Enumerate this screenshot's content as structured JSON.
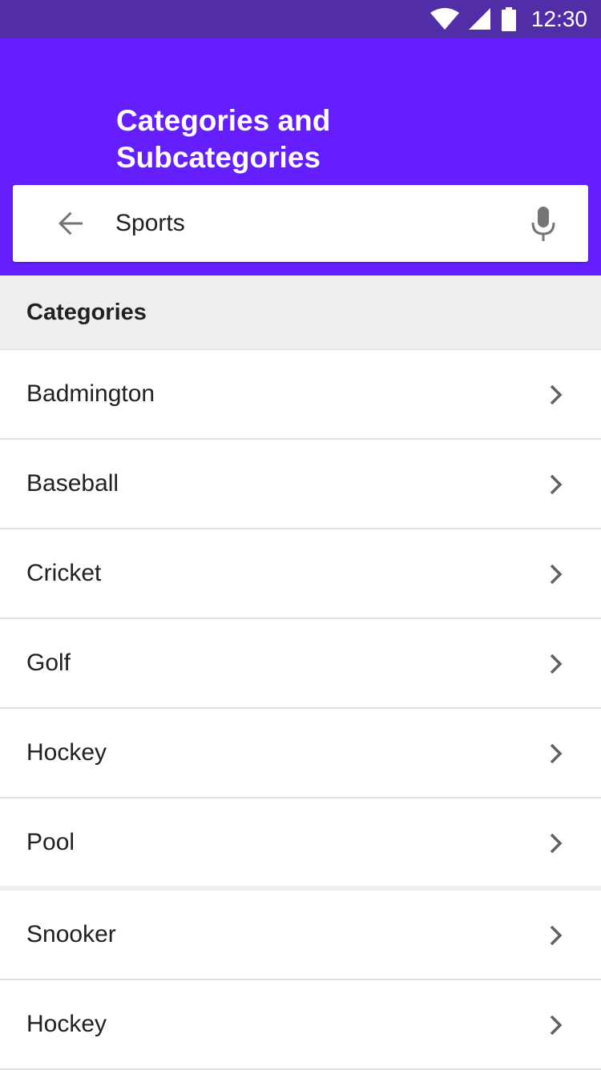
{
  "status_bar": {
    "time": "12:30",
    "icons": [
      "wifi-icon",
      "cellular-signal-icon",
      "battery-icon"
    ]
  },
  "app_bar": {
    "title": "Categories and Subcategories",
    "background_color": "#651FFF",
    "status_color": "#512DA8"
  },
  "search": {
    "value": "Sports",
    "back_icon": "arrow-back-icon",
    "mic_icon": "microphone-icon"
  },
  "section": {
    "header": "Categories"
  },
  "items": [
    {
      "label": "Badmington"
    },
    {
      "label": "Baseball"
    },
    {
      "label": "Cricket"
    },
    {
      "label": "Golf"
    },
    {
      "label": "Hockey"
    },
    {
      "label": "Pool"
    },
    {
      "label": "Snooker"
    },
    {
      "label": "Hockey"
    }
  ],
  "item_icon": "chevron-right-icon"
}
